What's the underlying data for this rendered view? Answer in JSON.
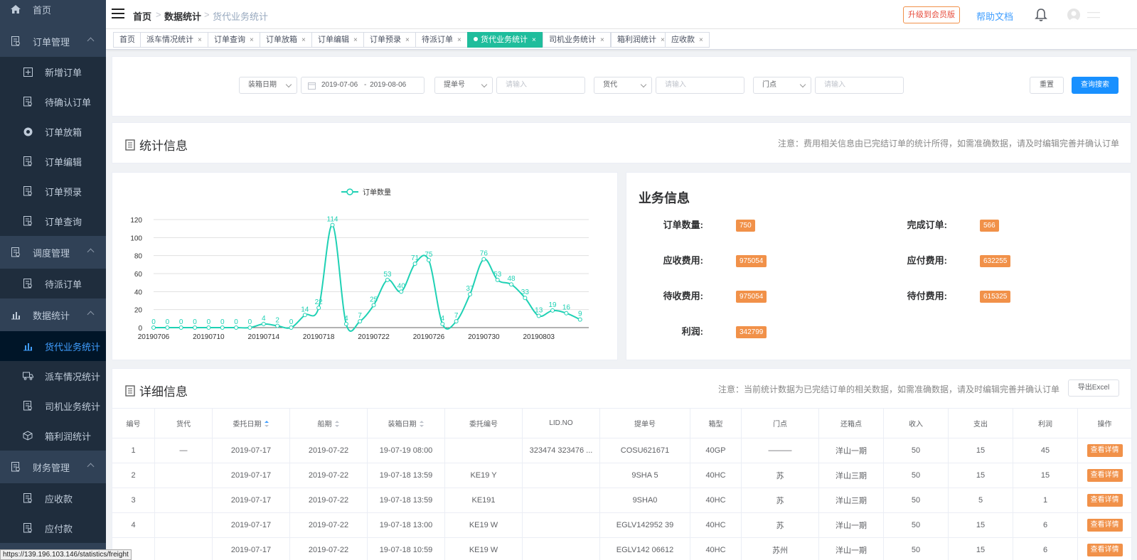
{
  "sidebar": {
    "items": [
      {
        "label": "首页",
        "icon": "home-icon",
        "type": "top"
      },
      {
        "label": "订单管理",
        "icon": "clipboard-icon",
        "type": "top",
        "expanded": true
      },
      {
        "label": "新增订单",
        "icon": "plus-square-icon",
        "type": "sub"
      },
      {
        "label": "待确认订单",
        "icon": "doc-search-icon",
        "type": "sub"
      },
      {
        "label": "订单放箱",
        "icon": "box-release-icon",
        "type": "sub"
      },
      {
        "label": "订单编辑",
        "icon": "doc-edit-icon",
        "type": "sub"
      },
      {
        "label": "订单预录",
        "icon": "pre-record-icon",
        "type": "sub"
      },
      {
        "label": "订单查询",
        "icon": "doc-search-icon",
        "type": "sub"
      },
      {
        "label": "调度管理",
        "icon": "schedule-icon",
        "type": "top",
        "expanded": true
      },
      {
        "label": "待派订单",
        "icon": "doc-search-icon",
        "type": "sub"
      },
      {
        "label": "数据统计",
        "icon": "bar-chart-icon",
        "type": "top",
        "expanded": true
      },
      {
        "label": "货代业务统计",
        "icon": "bar-chart-icon",
        "type": "sub",
        "active": true
      },
      {
        "label": "派车情况统计",
        "icon": "truck-icon",
        "type": "sub"
      },
      {
        "label": "司机业务统计",
        "icon": "driver-icon",
        "type": "sub"
      },
      {
        "label": "箱利润统计",
        "icon": "container-icon",
        "type": "sub"
      },
      {
        "label": "财务管理",
        "icon": "finance-icon",
        "type": "top",
        "expanded": true
      },
      {
        "label": "应收款",
        "icon": "receivable-icon",
        "type": "sub"
      },
      {
        "label": "应付款",
        "icon": "payable-icon",
        "type": "sub"
      }
    ]
  },
  "header": {
    "breadcrumb": [
      "首页",
      "数据统计",
      "货代业务统计"
    ],
    "upgrade_label": "升级到会员版",
    "help_label": "帮助文档"
  },
  "tags": [
    {
      "label": "首页",
      "closable": false
    },
    {
      "label": "派车情况统计",
      "closable": true
    },
    {
      "label": "订单查询",
      "closable": true
    },
    {
      "label": "订单放箱",
      "closable": true
    },
    {
      "label": "订单编辑",
      "closable": true
    },
    {
      "label": "订单预录",
      "closable": true
    },
    {
      "label": "待派订单",
      "closable": true
    },
    {
      "label": "货代业务统计",
      "closable": true,
      "active": true
    },
    {
      "label": "司机业务统计",
      "closable": true
    },
    {
      "label": "箱利润统计",
      "closable": true
    },
    {
      "label": "应收款",
      "closable": true
    }
  ],
  "filter": {
    "date_type": "装箱日期",
    "date_start": "2019-07-06",
    "date_sep": "-",
    "date_end": "2019-08-06",
    "field1_select": "提单号",
    "field1_placeholder": "请输入",
    "field2_select": "货代",
    "field2_placeholder": "请输入",
    "field3_select": "门点",
    "field3_placeholder": "请输入",
    "reset_label": "重置",
    "search_label": "查询搜索"
  },
  "stats": {
    "title": "统计信息",
    "note": "注意：费用相关信息由已完结订单的统计所得，如需准确数据，请及时编辑完善并确认订单"
  },
  "chart_data": {
    "type": "line",
    "legend": "订单数量",
    "legend_position": "top",
    "smooth": true,
    "color": "#1fd1b4",
    "ylim": [
      0,
      120
    ],
    "yticks": [
      0,
      20,
      40,
      60,
      80,
      100,
      120
    ],
    "xtick_labels": [
      "20190706",
      "20190710",
      "20190714",
      "20190718",
      "20190722",
      "20190726",
      "20190730",
      "20190803"
    ],
    "x": [
      "20190706",
      "20190707",
      "20190708",
      "20190709",
      "20190710",
      "20190711",
      "20190712",
      "20190713",
      "20190714",
      "20190715",
      "20190716",
      "20190717",
      "20190718",
      "20190719",
      "20190720",
      "20190721",
      "20190722",
      "20190723",
      "20190724",
      "20190725",
      "20190726",
      "20190727",
      "20190728",
      "20190729",
      "20190730",
      "20190731",
      "20190801",
      "20190802",
      "20190803",
      "20190804",
      "20190805",
      "20190806"
    ],
    "values": [
      0,
      0,
      0,
      0,
      0,
      0,
      0,
      0,
      4,
      2,
      0,
      14,
      22,
      114,
      4,
      7,
      25,
      53,
      40,
      71,
      75,
      4,
      7,
      37,
      76,
      53,
      48,
      33,
      13,
      19,
      16,
      9
    ]
  },
  "business": {
    "title": "业务信息",
    "items": [
      {
        "label": "订单数量:",
        "value": "750"
      },
      {
        "label": "完成订单:",
        "value": "566"
      },
      {
        "label": "应收费用:",
        "value": "975054"
      },
      {
        "label": "应付费用:",
        "value": "632255"
      },
      {
        "label": "待收费用:",
        "value": "975054"
      },
      {
        "label": "待付费用:",
        "value": "615325"
      },
      {
        "label": "利润:",
        "value": "342799"
      }
    ]
  },
  "detail": {
    "title": "详细信息",
    "note": "注意：当前统计数据为已完结订单的相关数据，如需准确数据，请及时编辑完善并确认订单",
    "export_label": "导出Excel",
    "columns": [
      "编号",
      "货代",
      "委托日期",
      "船期",
      "装箱日期",
      "委托编号",
      "LID.NO",
      "提单号",
      "箱型",
      "门点",
      "还箱点",
      "收入",
      "支出",
      "利润",
      "操作"
    ],
    "rows": [
      [
        "1",
        "—",
        "2019-07-17",
        "2019-07-22",
        "19-07-19 08:00",
        "",
        "323474 323476 ...",
        "COSU621671",
        "40GP",
        "———",
        "洋山一期",
        "50",
        "15",
        "45",
        "查看详情"
      ],
      [
        "2",
        "",
        "2019-07-17",
        "2019-07-22",
        "19-07-18 13:59",
        "KE19 Y",
        "",
        "9SHA 5",
        "40HC",
        "苏",
        "洋山三期",
        "50",
        "15",
        "15",
        "查看详情"
      ],
      [
        "3",
        "",
        "2019-07-17",
        "2019-07-22",
        "19-07-18 13:59",
        "KE191",
        "",
        "9SHA0",
        "40HC",
        "苏",
        "洋山三期",
        "50",
        "5",
        "1",
        "查看详情"
      ],
      [
        "4",
        "",
        "2019-07-17",
        "2019-07-22",
        "19-07-18 13:00",
        "KE19 W",
        "",
        "EGLV142952 39",
        "40HC",
        "苏",
        "洋山一期",
        "50",
        "15",
        "6",
        "查看详情"
      ],
      [
        "",
        "",
        "2019-07-17",
        "2019-07-22",
        "19-07-18 10:59",
        "KE19 W",
        "",
        "EGLV142 06612",
        "40HC",
        "苏州",
        "洋山一期",
        "50",
        "15",
        "6",
        "查看详情"
      ]
    ]
  },
  "statusbar": "https://139.196.103.146/statistics/freight"
}
